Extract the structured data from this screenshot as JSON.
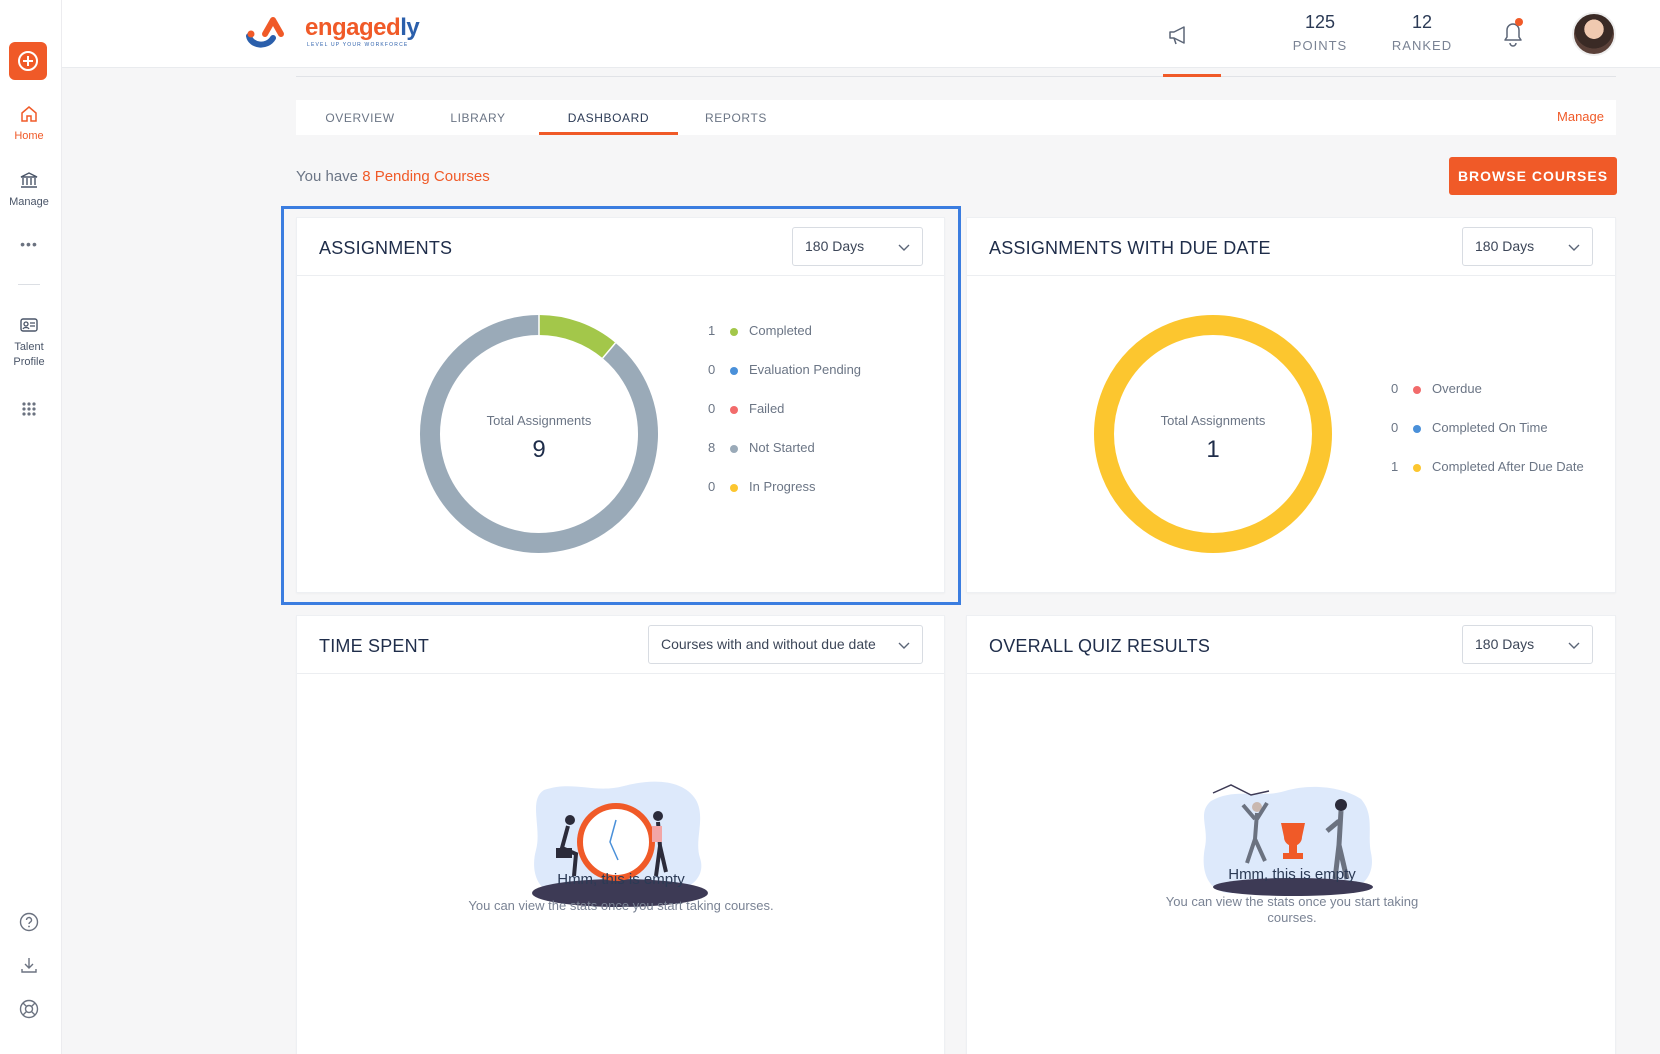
{
  "rail": {
    "items": [
      {
        "label": "Home",
        "icon": "home-icon"
      },
      {
        "label": "Manage",
        "icon": "bank-icon"
      },
      {
        "label": "Talent Profile",
        "icon": "id-card-icon"
      }
    ],
    "more": "•••"
  },
  "header": {
    "logo_name_part1": "engaged",
    "logo_name_part2": "ly",
    "logo_tagline": "LEVEL UP YOUR WORKFORCE",
    "points_value": "125",
    "points_label": "POINTS",
    "ranked_value": "12",
    "ranked_label": "RANKED"
  },
  "tabs": [
    "OVERVIEW",
    "LIBRARY",
    "DASHBOARD",
    "REPORTS"
  ],
  "active_tab": "DASHBOARD",
  "manage_label": "Manage",
  "pending": {
    "prefix": "You have ",
    "highlight": "8 Pending Courses"
  },
  "browse_label": "BROWSE COURSES",
  "colors": {
    "accent": "#f05a28",
    "green": "#a3c74a",
    "blue": "#4a90d9",
    "red": "#f26b6b",
    "gray": "#9aaab8",
    "yellow": "#fcc62f"
  },
  "assignments": {
    "title": "ASSIGNMENTS",
    "filter": "180 Days",
    "center_label": "Total Assignments",
    "total": "9",
    "legend": [
      {
        "count": "1",
        "label": "Completed",
        "color": "#a3c74a"
      },
      {
        "count": "0",
        "label": "Evaluation Pending",
        "color": "#4a90d9"
      },
      {
        "count": "0",
        "label": "Failed",
        "color": "#f26b6b"
      },
      {
        "count": "8",
        "label": "Not Started",
        "color": "#9aaab8"
      },
      {
        "count": "0",
        "label": "In Progress",
        "color": "#fcc62f"
      }
    ]
  },
  "due": {
    "title": "ASSIGNMENTS WITH DUE DATE",
    "filter": "180 Days",
    "center_label": "Total Assignments",
    "total": "1",
    "legend": [
      {
        "count": "0",
        "label": "Overdue",
        "color": "#f26b6b"
      },
      {
        "count": "0",
        "label": "Completed On Time",
        "color": "#4a90d9"
      },
      {
        "count": "1",
        "label": "Completed After Due Date",
        "color": "#fcc62f"
      }
    ]
  },
  "time_spent": {
    "title": "TIME SPENT",
    "filter": "Courses with and without due date",
    "empty_title": "Hmm, this is empty",
    "empty_sub": "You can view the stats once you start taking courses."
  },
  "quiz": {
    "title": "OVERALL QUIZ RESULTS",
    "filter": "180 Days",
    "empty_title": "Hmm, this is empty",
    "empty_sub_line1": "You can view the stats once you start taking",
    "empty_sub_line2": "courses."
  },
  "chart_data": [
    {
      "type": "pie",
      "title": "ASSIGNMENTS",
      "categories": [
        "Completed",
        "Evaluation Pending",
        "Failed",
        "Not Started",
        "In Progress"
      ],
      "values": [
        1,
        0,
        0,
        8,
        0
      ]
    },
    {
      "type": "pie",
      "title": "ASSIGNMENTS WITH DUE DATE",
      "categories": [
        "Overdue",
        "Completed On Time",
        "Completed After Due Date"
      ],
      "values": [
        0,
        0,
        1
      ]
    }
  ]
}
